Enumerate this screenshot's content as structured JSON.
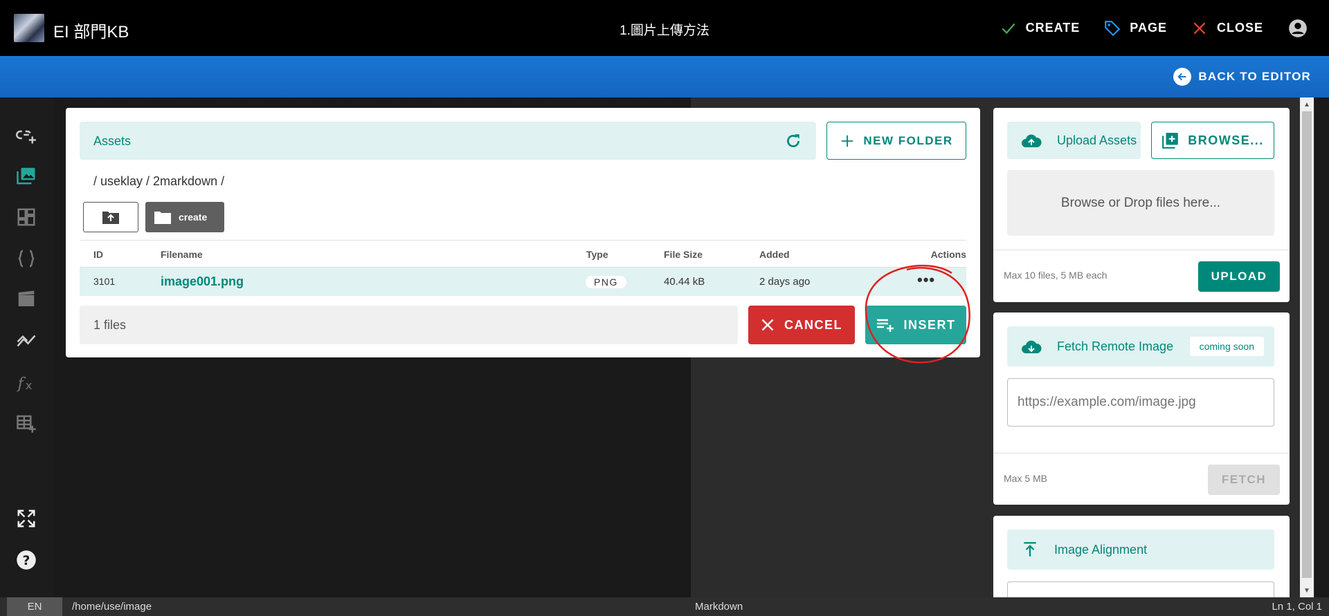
{
  "header": {
    "app_title": "EI 部門KB",
    "page_title": "1.圖片上傳方法",
    "actions": [
      {
        "label": "CREATE",
        "icon": "check-icon",
        "color": "#4caf50"
      },
      {
        "label": "PAGE",
        "icon": "tag-icon",
        "color": "#2196f3"
      },
      {
        "label": "CLOSE",
        "icon": "close-icon",
        "color": "#f44336"
      }
    ]
  },
  "bluebar": {
    "back_label": "BACK TO EDITOR"
  },
  "sidebar": {
    "icons": [
      "link-plus-icon",
      "image-icon",
      "dashboard-icon",
      "code-braces-icon",
      "video-icon",
      "chart-icon",
      "function-icon",
      "table-plus-icon",
      "fullscreen-icon",
      "help-icon"
    ]
  },
  "assets_dialog": {
    "title": "Assets",
    "new_folder_label": "NEW FOLDER",
    "breadcrumb": "/ useklay / 2markdown /",
    "create_folder_label": "create",
    "columns": [
      "ID",
      "Filename",
      "Type",
      "File Size",
      "Added",
      "Actions"
    ],
    "rows": [
      {
        "id": "3101",
        "filename": "image001.png",
        "type": "PNG",
        "size": "40.44 kB",
        "added": "2 days ago",
        "actions": "•••"
      }
    ],
    "files_count": "1 files",
    "cancel_label": "CANCEL",
    "insert_label": "INSERT"
  },
  "upload_card": {
    "upload_assets_label": "Upload Assets",
    "browse_label": "BROWSE...",
    "drop_text": "Browse or Drop files here...",
    "limit_text": "Max 10 files, 5 MB each",
    "upload_label": "UPLOAD"
  },
  "fetch_card": {
    "title": "Fetch Remote Image",
    "badge": "coming soon",
    "placeholder": "https://example.com/image.jpg",
    "limit_text": "Max 5 MB",
    "fetch_label": "FETCH"
  },
  "align_card": {
    "title": "Image Alignment"
  },
  "statusbar": {
    "lang": "EN",
    "path": "/home/use/image",
    "mode": "Markdown",
    "position": "Ln 1, Col 1"
  },
  "colors": {
    "accent": "#00897b",
    "blue": "#1976d2",
    "danger": "#d32f2f"
  }
}
